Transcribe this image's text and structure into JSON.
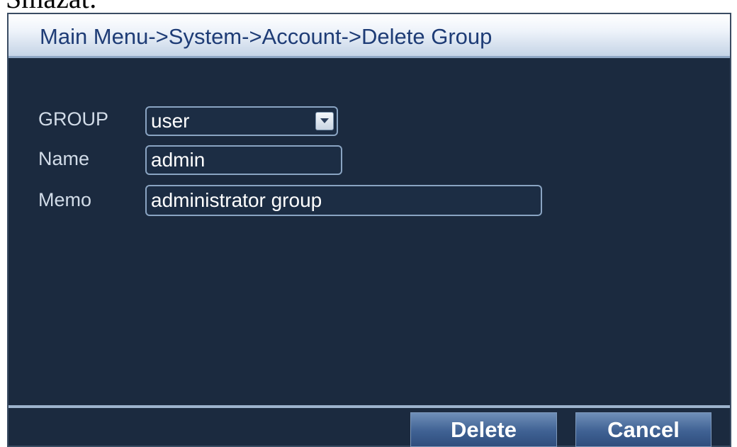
{
  "page_fragment": "Smazat:",
  "window": {
    "title": "Main Menu->System->Account->Delete Group"
  },
  "form": {
    "group_label": "GROUP",
    "group_value": "user",
    "name_label": "Name",
    "name_value": "admin",
    "memo_label": "Memo",
    "memo_value": "administrator group"
  },
  "buttons": {
    "delete_label": "Delete",
    "cancel_label": "Cancel"
  },
  "icons": {
    "dropdown": "chevron-down-icon"
  },
  "colors": {
    "panel_background": "#1b2a3f",
    "title_text": "#1e3c76",
    "button": "#3f6193"
  }
}
